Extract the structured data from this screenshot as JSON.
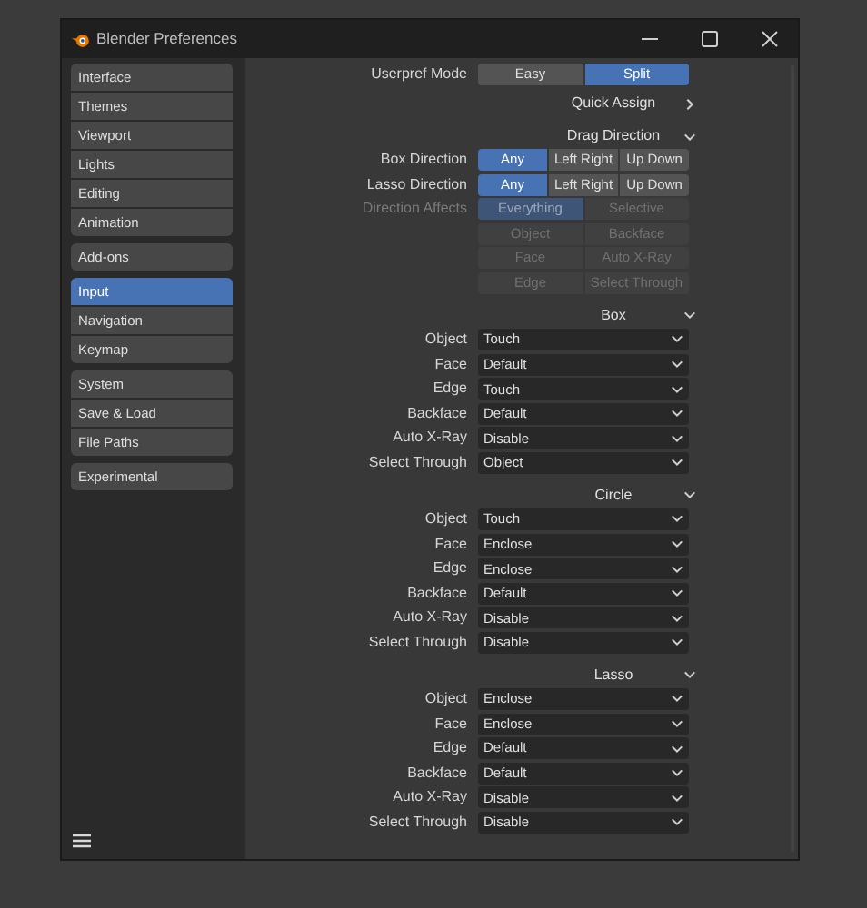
{
  "window": {
    "title": "Blender Preferences"
  },
  "sidebar": {
    "groups": [
      [
        {
          "label": "Interface",
          "selected": false
        },
        {
          "label": "Themes",
          "selected": false
        },
        {
          "label": "Viewport",
          "selected": false
        },
        {
          "label": "Lights",
          "selected": false
        },
        {
          "label": "Editing",
          "selected": false
        },
        {
          "label": "Animation",
          "selected": false
        }
      ],
      [
        {
          "label": "Add-ons",
          "selected": false
        }
      ],
      [
        {
          "label": "Input",
          "selected": true
        },
        {
          "label": "Navigation",
          "selected": false
        },
        {
          "label": "Keymap",
          "selected": false
        }
      ],
      [
        {
          "label": "System",
          "selected": false
        },
        {
          "label": "Save & Load",
          "selected": false
        },
        {
          "label": "File Paths",
          "selected": false
        }
      ],
      [
        {
          "label": "Experimental",
          "selected": false
        }
      ]
    ]
  },
  "userpref_mode": {
    "label": "Userpref Mode",
    "options": [
      {
        "label": "Easy",
        "selected": false
      },
      {
        "label": "Split",
        "selected": true
      }
    ]
  },
  "panels": [
    {
      "title": "Quick Assign",
      "expanded": false
    },
    {
      "title": "Drag Direction",
      "expanded": true,
      "rows": [
        {
          "kind": "segmented",
          "label": "Box Direction",
          "disabled": false,
          "options": [
            {
              "label": "Any",
              "selected": true
            },
            {
              "label": "Left Right",
              "selected": false
            },
            {
              "label": "Up Down",
              "selected": false
            }
          ]
        },
        {
          "kind": "segmented",
          "label": "Lasso Direction",
          "disabled": false,
          "options": [
            {
              "label": "Any",
              "selected": true
            },
            {
              "label": "Left Right",
              "selected": false
            },
            {
              "label": "Up Down",
              "selected": false
            }
          ]
        },
        {
          "kind": "segmented",
          "label": "Direction Affects",
          "disabled": true,
          "options": [
            {
              "label": "Everything",
              "selected": true
            },
            {
              "label": "Selective",
              "selected": false
            }
          ]
        },
        {
          "kind": "segmented",
          "disabled": true,
          "options": [
            {
              "label": "Object",
              "selected": false
            },
            {
              "label": "Backface",
              "selected": false
            }
          ]
        },
        {
          "kind": "segmented",
          "disabled": true,
          "options": [
            {
              "label": "Face",
              "selected": false
            },
            {
              "label": "Auto X-Ray",
              "selected": false
            }
          ]
        },
        {
          "kind": "segmented",
          "disabled": true,
          "options": [
            {
              "label": "Edge",
              "selected": false
            },
            {
              "label": "Select Through",
              "selected": false
            }
          ]
        }
      ]
    },
    {
      "title": "Box",
      "expanded": true,
      "rows": [
        {
          "kind": "dropdown",
          "label": "Object",
          "value": "Touch"
        },
        {
          "kind": "dropdown",
          "label": "Face",
          "value": "Default"
        },
        {
          "kind": "dropdown",
          "label": "Edge",
          "value": "Touch"
        },
        {
          "kind": "dropdown",
          "label": "Backface",
          "value": "Default"
        },
        {
          "kind": "dropdown",
          "label": "Auto X-Ray",
          "value": "Disable"
        },
        {
          "kind": "dropdown",
          "label": "Select Through",
          "value": "Object"
        }
      ]
    },
    {
      "title": "Circle",
      "expanded": true,
      "rows": [
        {
          "kind": "dropdown",
          "label": "Object",
          "value": "Touch"
        },
        {
          "kind": "dropdown",
          "label": "Face",
          "value": "Enclose"
        },
        {
          "kind": "dropdown",
          "label": "Edge",
          "value": "Enclose"
        },
        {
          "kind": "dropdown",
          "label": "Backface",
          "value": "Default"
        },
        {
          "kind": "dropdown",
          "label": "Auto X-Ray",
          "value": "Disable"
        },
        {
          "kind": "dropdown",
          "label": "Select Through",
          "value": "Disable"
        }
      ]
    },
    {
      "title": "Lasso",
      "expanded": true,
      "rows": [
        {
          "kind": "dropdown",
          "label": "Object",
          "value": "Enclose"
        },
        {
          "kind": "dropdown",
          "label": "Face",
          "value": "Enclose"
        },
        {
          "kind": "dropdown",
          "label": "Edge",
          "value": "Default"
        },
        {
          "kind": "dropdown",
          "label": "Backface",
          "value": "Default"
        },
        {
          "kind": "dropdown",
          "label": "Auto X-Ray",
          "value": "Disable"
        },
        {
          "kind": "dropdown",
          "label": "Select Through",
          "value": "Disable"
        }
      ]
    }
  ]
}
